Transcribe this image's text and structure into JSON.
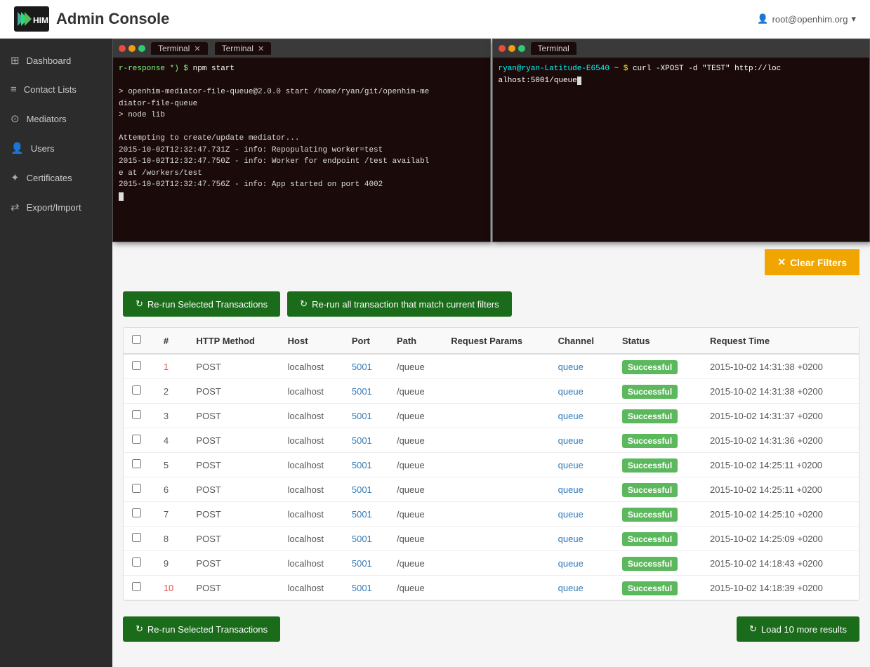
{
  "navbar": {
    "title": "Admin Console",
    "user": "root@openhim.org"
  },
  "sidebar": {
    "items": [
      {
        "id": "dashboard",
        "label": "Dashboard",
        "icon": "⊞"
      },
      {
        "id": "contact-lists",
        "label": "Contact Lists",
        "icon": "≡"
      },
      {
        "id": "mediators",
        "label": "Mediators",
        "icon": "⊙"
      },
      {
        "id": "users",
        "label": "Users",
        "icon": "👤"
      },
      {
        "id": "certificates",
        "label": "Certificates",
        "icon": "✦"
      },
      {
        "id": "export-import",
        "label": "Export/Import",
        "icon": "⇄"
      }
    ]
  },
  "terminals": {
    "left": {
      "tabs": [
        "Terminal",
        "Terminal"
      ],
      "content": [
        {
          "type": "prompt",
          "text": "r-response *) $ npm start"
        },
        {
          "type": "info",
          "text": ""
        },
        {
          "type": "info",
          "text": "> openhim-mediator-file-queue@2.0.0 start /home/ryan/git/openhim-mediator-file-queue"
        },
        {
          "type": "info",
          "text": "> node lib"
        },
        {
          "type": "info",
          "text": ""
        },
        {
          "type": "info",
          "text": "Attempting to create/update mediator..."
        },
        {
          "type": "info",
          "text": "2015-10-02T12:32:47.731Z - info: Repopulating worker=test"
        },
        {
          "type": "info",
          "text": "2015-10-02T12:32:47.750Z - info: Worker for endpoint /test available at /workers/test"
        },
        {
          "type": "info",
          "text": "2015-10-02T12:32:47.756Z - info: App started on port 4002"
        }
      ]
    },
    "right": {
      "tabs": [
        "Terminal"
      ],
      "content": [
        {
          "type": "prompt",
          "text": "ryan@ryan-Latitude-E6540 ~ $ curl -XPOST -d \"TEST\" http://localhost:5001/queue"
        }
      ]
    }
  },
  "clear_filters": {
    "label": "Clear Filters"
  },
  "buttons": {
    "rerun_selected": "Re-run Selected Transactions",
    "rerun_all": "Re-run all transaction that match current filters",
    "rerun_bottom": "Re-run Selected Transactions",
    "load_more": "Load 10 more results"
  },
  "table": {
    "headers": [
      "",
      "#",
      "HTTP Method",
      "Host",
      "Port",
      "Path",
      "Request Params",
      "Channel",
      "Status",
      "Request Time"
    ],
    "rows": [
      {
        "id": 1,
        "method": "POST",
        "host": "localhost",
        "port": "5001",
        "path": "/queue",
        "params": "",
        "channel": "queue",
        "status": "Successful",
        "time": "2015-10-02 14:31:38 +0200",
        "highlight": true
      },
      {
        "id": 2,
        "method": "POST",
        "host": "localhost",
        "port": "5001",
        "path": "/queue",
        "params": "",
        "channel": "queue",
        "status": "Successful",
        "time": "2015-10-02 14:31:38 +0200",
        "highlight": false
      },
      {
        "id": 3,
        "method": "POST",
        "host": "localhost",
        "port": "5001",
        "path": "/queue",
        "params": "",
        "channel": "queue",
        "status": "Successful",
        "time": "2015-10-02 14:31:37 +0200",
        "highlight": false
      },
      {
        "id": 4,
        "method": "POST",
        "host": "localhost",
        "port": "5001",
        "path": "/queue",
        "params": "",
        "channel": "queue",
        "status": "Successful",
        "time": "2015-10-02 14:31:36 +0200",
        "highlight": false
      },
      {
        "id": 5,
        "method": "POST",
        "host": "localhost",
        "port": "5001",
        "path": "/queue",
        "params": "",
        "channel": "queue",
        "status": "Successful",
        "time": "2015-10-02 14:25:11 +0200",
        "highlight": false
      },
      {
        "id": 6,
        "method": "POST",
        "host": "localhost",
        "port": "5001",
        "path": "/queue",
        "params": "",
        "channel": "queue",
        "status": "Successful",
        "time": "2015-10-02 14:25:11 +0200",
        "highlight": false
      },
      {
        "id": 7,
        "method": "POST",
        "host": "localhost",
        "port": "5001",
        "path": "/queue",
        "params": "",
        "channel": "queue",
        "status": "Successful",
        "time": "2015-10-02 14:25:10 +0200",
        "highlight": false
      },
      {
        "id": 8,
        "method": "POST",
        "host": "localhost",
        "port": "5001",
        "path": "/queue",
        "params": "",
        "channel": "queue",
        "status": "Successful",
        "time": "2015-10-02 14:25:09 +0200",
        "highlight": false
      },
      {
        "id": 9,
        "method": "POST",
        "host": "localhost",
        "port": "5001",
        "path": "/queue",
        "params": "",
        "channel": "queue",
        "status": "Successful",
        "time": "2015-10-02 14:18:43 +0200",
        "highlight": false
      },
      {
        "id": 10,
        "method": "POST",
        "host": "localhost",
        "port": "5001",
        "path": "/queue",
        "params": "",
        "channel": "queue",
        "status": "Successful",
        "time": "2015-10-02 14:18:39 +0200",
        "highlight": true
      }
    ]
  },
  "colors": {
    "success_bg": "#5cb85c",
    "btn_green": "#1a6b1a",
    "clear_filters_bg": "#f0a500",
    "sidebar_bg": "#2c2c2c"
  }
}
